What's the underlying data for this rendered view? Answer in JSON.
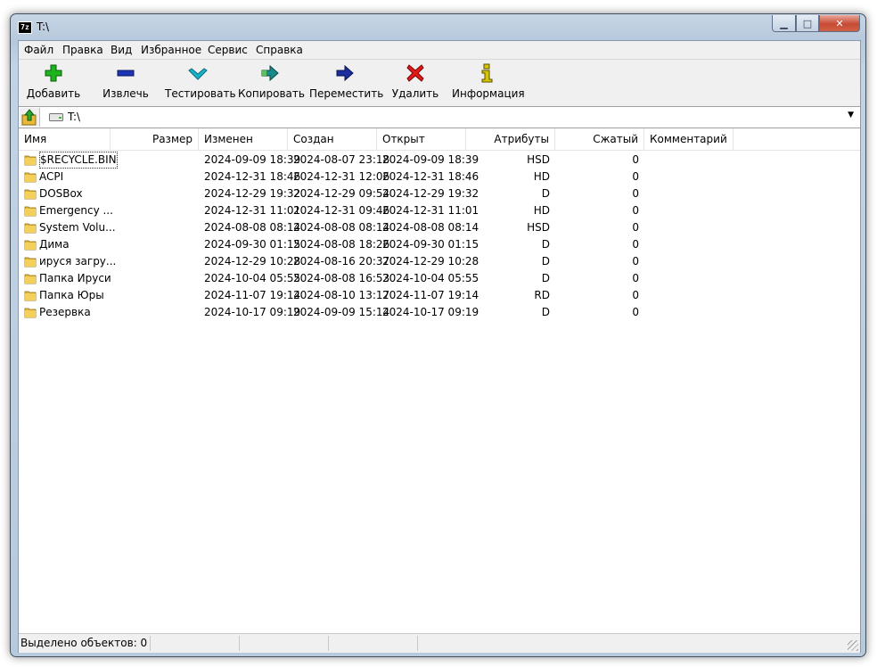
{
  "window": {
    "title": "T:\\",
    "app_icon_text": "7z"
  },
  "menu": [
    "Файл",
    "Правка",
    "Вид",
    "Избранное",
    "Сервис",
    "Справка"
  ],
  "toolbar": {
    "add": "Добавить",
    "extract": "Извлечь",
    "test": "Тестировать",
    "copy": "Копировать",
    "move": "Переместить",
    "delete": "Удалить",
    "info": "Информация"
  },
  "address": {
    "path": "T:\\"
  },
  "columns": {
    "name": "Имя",
    "size": "Размер",
    "modified": "Изменен",
    "created": "Создан",
    "accessed": "Открыт",
    "attributes": "Атрибуты",
    "packed": "Сжатый",
    "comment": "Комментарий"
  },
  "files": [
    {
      "name": "$RECYCLE.BIN",
      "modified": "2024-09-09 18:39",
      "created": "2024-08-07 23:18",
      "accessed": "2024-09-09 18:39",
      "attributes": "HSD",
      "packed": "0"
    },
    {
      "name": "ACPI",
      "modified": "2024-12-31 18:46",
      "created": "2024-12-31 12:06",
      "accessed": "2024-12-31 18:46",
      "attributes": "HD",
      "packed": "0"
    },
    {
      "name": "DOSBox",
      "modified": "2024-12-29 19:32",
      "created": "2024-12-29 09:54",
      "accessed": "2024-12-29 19:32",
      "attributes": "D",
      "packed": "0"
    },
    {
      "name": "Emergency ...",
      "modified": "2024-12-31 11:01",
      "created": "2024-12-31 09:46",
      "accessed": "2024-12-31 11:01",
      "attributes": "HD",
      "packed": "0"
    },
    {
      "name": "System Volu...",
      "modified": "2024-08-08 08:14",
      "created": "2024-08-08 08:14",
      "accessed": "2024-08-08 08:14",
      "attributes": "HSD",
      "packed": "0"
    },
    {
      "name": "Дима",
      "modified": "2024-09-30 01:15",
      "created": "2024-08-08 18:26",
      "accessed": "2024-09-30 01:15",
      "attributes": "D",
      "packed": "0"
    },
    {
      "name": "ируся загру...",
      "modified": "2024-12-29 10:28",
      "created": "2024-08-16 20:37",
      "accessed": "2024-12-29 10:28",
      "attributes": "D",
      "packed": "0"
    },
    {
      "name": "Папка Ируси",
      "modified": "2024-10-04 05:55",
      "created": "2024-08-08 16:53",
      "accessed": "2024-10-04 05:55",
      "attributes": "D",
      "packed": "0"
    },
    {
      "name": "Папка Юры",
      "modified": "2024-11-07 19:14",
      "created": "2024-08-10 13:17",
      "accessed": "2024-11-07 19:14",
      "attributes": "RD",
      "packed": "0"
    },
    {
      "name": "Резервка",
      "modified": "2024-10-17 09:19",
      "created": "2024-09-09 15:14",
      "accessed": "2024-10-17 09:19",
      "attributes": "D",
      "packed": "0"
    }
  ],
  "status": {
    "selected": "Выделено объектов: 0"
  },
  "colors": {
    "folder": "#e8b93a",
    "add": "#1db31d",
    "extract": "#1c35b5",
    "test": "#19b3c9",
    "copy": "#1a8a8a",
    "move": "#1c2d9e",
    "delete": "#e01919",
    "info": "#d8c400"
  }
}
